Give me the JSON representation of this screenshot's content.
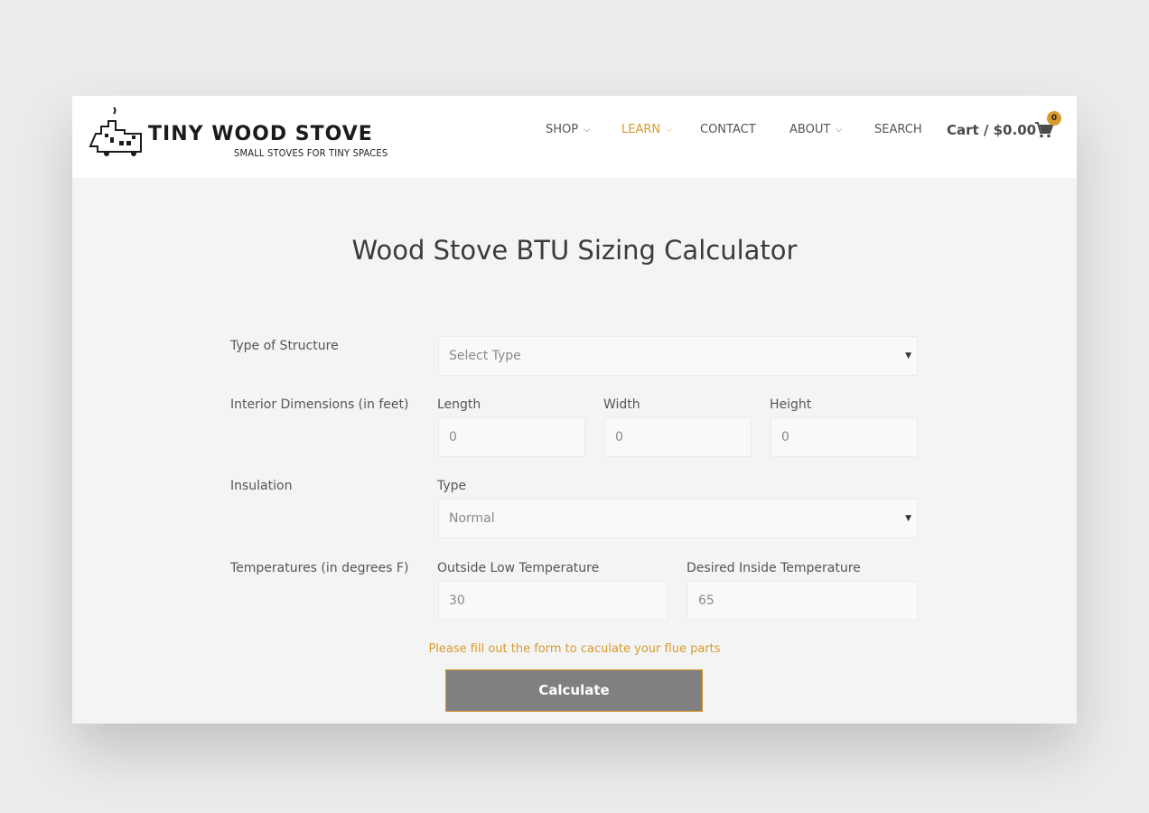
{
  "brand": {
    "title": "TINY WOOD STOVE",
    "tagline": "SMALL STOVES FOR TINY SPACES"
  },
  "nav": {
    "shop": "SHOP",
    "learn": "LEARN",
    "contact": "CONTACT",
    "about": "ABOUT",
    "search": "SEARCH",
    "active": "LEARN"
  },
  "cart": {
    "label": "Cart / $0.00",
    "count": "0"
  },
  "colors": {
    "accent": "#d89a2e",
    "button": "#808080",
    "page_bg": "#f4f4f4"
  },
  "page": {
    "title": "Wood Stove BTU Sizing Calculator"
  },
  "form": {
    "structure": {
      "row_label": "Type of Structure",
      "value": "Select Type"
    },
    "dimensions": {
      "row_label": "Interior Dimensions (in feet)",
      "length_label": "Length",
      "length_value": "0",
      "width_label": "Width",
      "width_value": "0",
      "height_label": "Height",
      "height_value": "0"
    },
    "insulation": {
      "row_label": "Insulation",
      "type_label": "Type",
      "value": "Normal"
    },
    "temperatures": {
      "row_label": "Temperatures (in degrees F)",
      "outside_label": "Outside Low Temperature",
      "outside_value": "30",
      "inside_label": "Desired Inside Temperature",
      "inside_value": "65"
    },
    "message": "Please fill out the form to caculate your flue parts",
    "submit_label": "Calculate"
  }
}
